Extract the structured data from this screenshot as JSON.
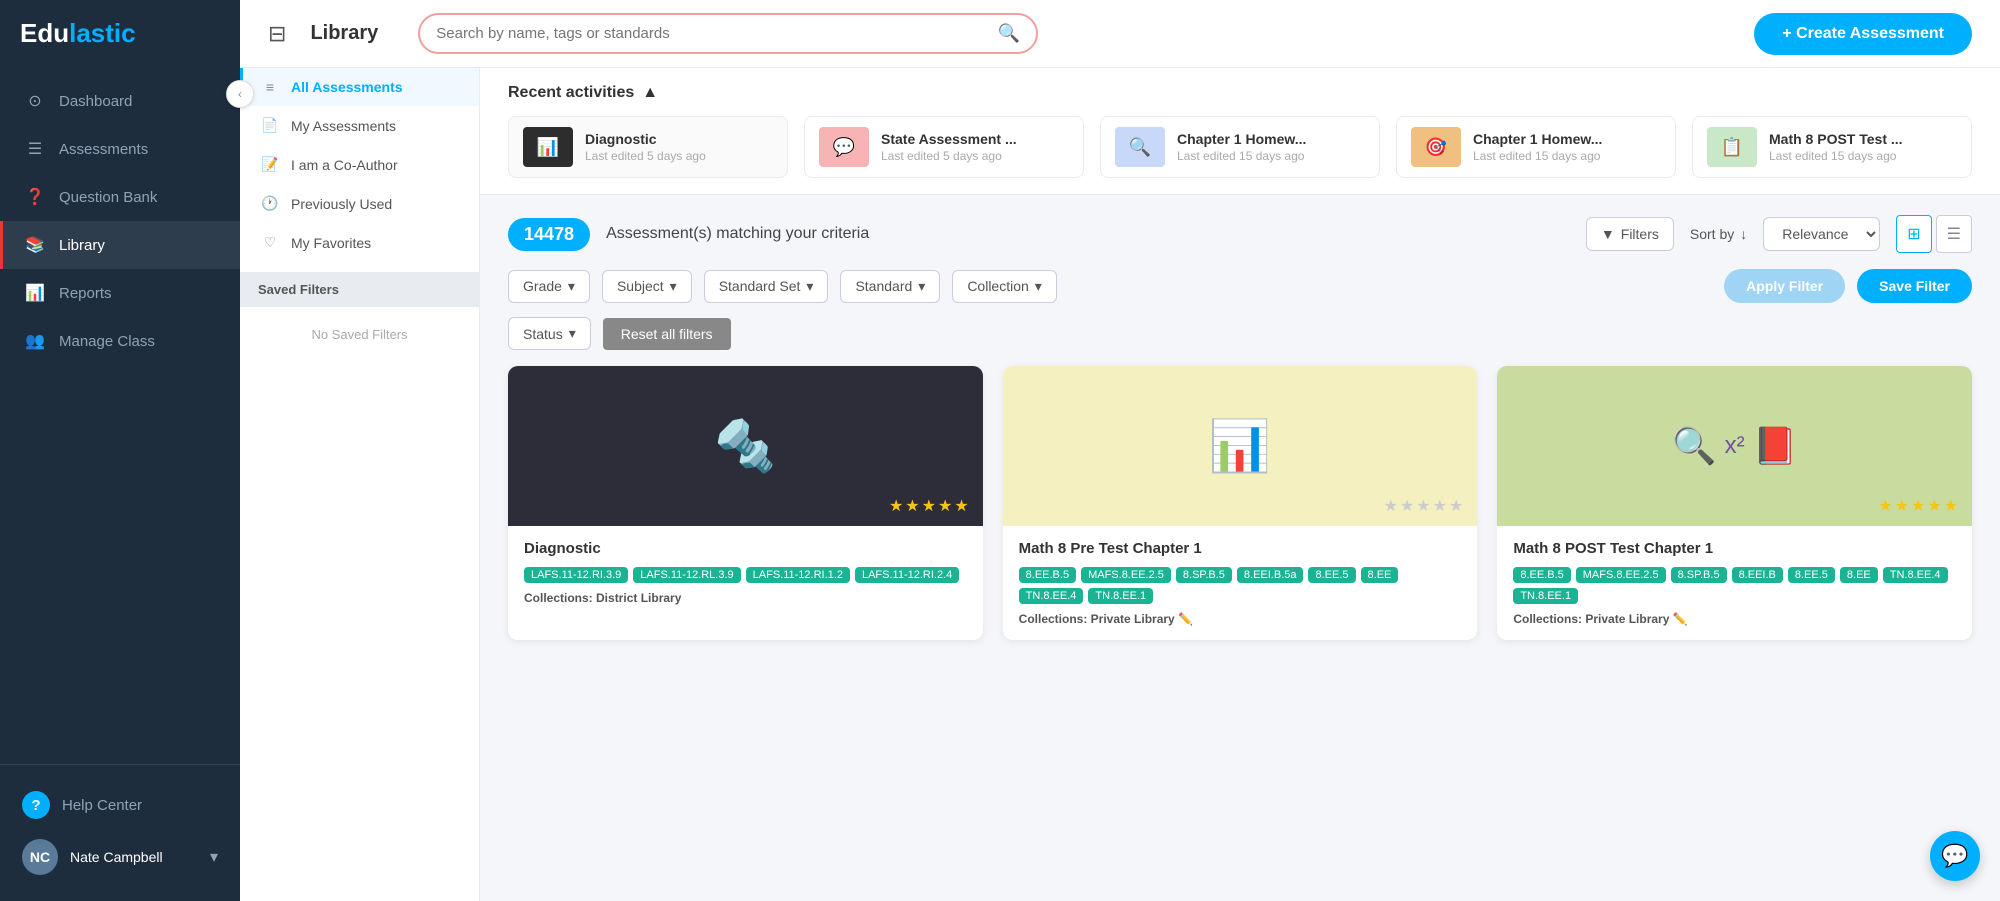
{
  "app": {
    "logo_edu": "Edu",
    "logo_lastic": "lastic"
  },
  "sidebar": {
    "nav_items": [
      {
        "id": "dashboard",
        "label": "Dashboard",
        "icon": "⊙",
        "active": false
      },
      {
        "id": "assessments",
        "label": "Assessments",
        "icon": "📋",
        "active": false
      },
      {
        "id": "question-bank",
        "label": "Question Bank",
        "icon": "❓",
        "active": false
      },
      {
        "id": "library",
        "label": "Library",
        "icon": "📚",
        "active": true
      },
      {
        "id": "reports",
        "label": "Reports",
        "icon": "📊",
        "active": false
      },
      {
        "id": "manage-class",
        "label": "Manage Class",
        "icon": "👥",
        "active": false
      }
    ],
    "help_label": "Help Center",
    "user_name": "Nate Campbell",
    "user_initials": "NC"
  },
  "header": {
    "library_title": "Library",
    "search_placeholder": "Search by name, tags or standards",
    "create_button": "+ Create Assessment"
  },
  "left_panel": {
    "filter_items": [
      {
        "id": "all",
        "label": "All Assessments",
        "icon": "≡",
        "active": true
      },
      {
        "id": "my-assessments",
        "label": "My Assessments",
        "icon": "📄",
        "active": false
      },
      {
        "id": "co-author",
        "label": "I am a Co-Author",
        "icon": "📝",
        "active": false
      },
      {
        "id": "previously-used",
        "label": "Previously Used",
        "icon": "🕐",
        "active": false
      },
      {
        "id": "my-favorites",
        "label": "My Favorites",
        "icon": "♡",
        "active": false
      }
    ],
    "saved_filters_title": "Saved Filters",
    "no_saved_text": "No Saved Filters"
  },
  "recent_activities": {
    "title": "Recent activities",
    "items": [
      {
        "id": 1,
        "name": "Diagnostic",
        "date": "Last edited 5 days ago",
        "bg": "#2d2d2d",
        "icon": "📊"
      },
      {
        "id": 2,
        "name": "State Assessment ...",
        "date": "Last edited 5 days ago",
        "bg": "#f8b4b4",
        "icon": "💬"
      },
      {
        "id": 3,
        "name": "Chapter 1 Homew...",
        "date": "Last edited 15 days ago",
        "bg": "#c8d8f8",
        "icon": "🔍"
      },
      {
        "id": 4,
        "name": "Chapter 1 Homew...",
        "date": "Last edited 15 days ago",
        "bg": "#f0c080",
        "icon": "🎯"
      },
      {
        "id": 5,
        "name": "Math 8 POST Test ...",
        "date": "Last edited 15 days ago",
        "bg": "#c8e8c8",
        "icon": "📋"
      }
    ]
  },
  "assessments_header": {
    "count": "14478",
    "matching_text": "Assessment(s) matching your criteria",
    "filters_label": "Filters",
    "sort_label": "Sort by",
    "relevance_label": "Relevance",
    "apply_filter": "Apply Filter",
    "save_filter": "Save Filter",
    "reset_label": "Reset all filters"
  },
  "filter_dropdowns": [
    {
      "id": "grade",
      "label": "Grade"
    },
    {
      "id": "subject",
      "label": "Subject"
    },
    {
      "id": "standard-set",
      "label": "Standard Set"
    },
    {
      "id": "standard",
      "label": "Standard"
    },
    {
      "id": "collection",
      "label": "Collection"
    },
    {
      "id": "status",
      "label": "Status"
    }
  ],
  "cards": [
    {
      "id": 1,
      "title": "Diagnostic",
      "bg": "#2d2d3a",
      "icon": "🔩",
      "stars": "★★★★★",
      "tags": [
        "LAFS.11-12.RI.3.9",
        "LAFS.11-12.RL.3.9",
        "LAFS.11-12.RI.1.2",
        "LAFS.11-12.RI.2.4"
      ],
      "collections": "District Library"
    },
    {
      "id": 2,
      "title": "Math 8 Pre Test Chapter 1",
      "bg": "#f5f0c0",
      "icon": "📊",
      "stars": "★★★★★",
      "tags": [
        "8.EE.B.5",
        "MAFS.8.EE.2.5",
        "8.SP.B.5",
        "8.EEI.B.5a",
        "8.EE.5",
        "8.EE",
        "TN.8.EE.4",
        "TN.8.EE.1"
      ],
      "collections": "Private Library"
    },
    {
      "id": 3,
      "title": "Math 8 POST Test Chapter 1",
      "bg": "#c8dca0",
      "icon": "🔍",
      "stars": "★★★★★",
      "tags": [
        "8.EE.B.5",
        "MAFS.8.EE.2.5",
        "8.SP.B.5",
        "8.EEI.B",
        "8.EE.5",
        "8.EE",
        "TN.8.EE.4",
        "TN.8.EE.1"
      ],
      "collections": "Private Library"
    }
  ]
}
